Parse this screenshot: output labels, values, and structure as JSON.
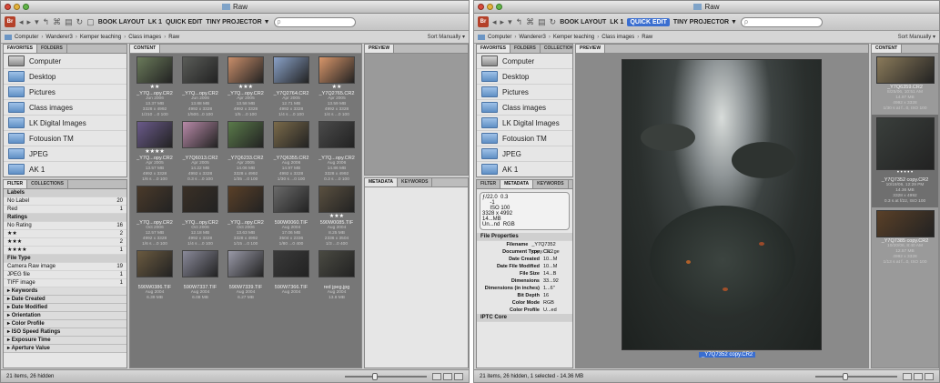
{
  "left_window": {
    "title": "Raw",
    "toolbar": {
      "workspaces": [
        "BOOK LAYOUT",
        "LK 1",
        "QUICK EDIT",
        "TINY PROJECTOR ▼"
      ],
      "search_placeholder": "ρ"
    },
    "path": [
      "Computer",
      "Wanderer3",
      "Kemper teaching",
      "Class images",
      "Raw"
    ],
    "sort_label": "Sort Manually ▾",
    "favorites_tabs": [
      "FAVORITES",
      "FOLDERS"
    ],
    "favorites": [
      "Computer",
      "Desktop",
      "Pictures",
      "Class images",
      "LK Digital Images",
      "Fotousion TM",
      "JPEG",
      "AK 1"
    ],
    "filter_tabs": [
      "FILTER",
      "COLLECTIONS"
    ],
    "filter": {
      "labels_header": "Labels",
      "labels": [
        {
          "name": "No Label",
          "count": "20"
        },
        {
          "name": "Red",
          "count": "1"
        }
      ],
      "ratings_header": "Ratings",
      "ratings": [
        {
          "name": "No Rating",
          "count": "16"
        },
        {
          "name": "★★",
          "count": "2"
        },
        {
          "name": "★★★",
          "count": "2"
        },
        {
          "name": "★★★★",
          "count": "1"
        }
      ],
      "filetype_header": "File Type",
      "filetypes": [
        {
          "name": "Camera Raw image",
          "count": "19"
        },
        {
          "name": "JPEG file",
          "count": "1"
        },
        {
          "name": "TIFF image",
          "count": "1"
        }
      ],
      "collapsed": [
        "Keywords",
        "Date Created",
        "Date Modified",
        "Orientation",
        "Color Profile",
        "ISO Speed Ratings",
        "Exposure Time",
        "Aperture Value"
      ]
    },
    "content_tab": "CONTENT",
    "preview_tab": "PREVIEW",
    "metadata_tabs": [
      "METADATA",
      "KEYWORDS"
    ],
    "thumbnails": [
      {
        "name": "_Y7Q...opy.CR2",
        "stars": "★★",
        "meta": [
          "Jun 2006",
          "13.37 MB",
          "3328 x 4992",
          "1/210 ...0 100"
        ],
        "color": "#6a7a5a"
      },
      {
        "name": "_Y7Q...opy.CR2",
        "stars": "",
        "meta": [
          "Jun 2006",
          "13.88 MB",
          "4992 x 3328",
          "1/500...0 100"
        ],
        "color": "#5a5c58"
      },
      {
        "name": "_Y7Q...opy.CR2",
        "stars": "★★★",
        "meta": [
          "Apr 2005",
          "13.58 MB",
          "4992 x 3328",
          "1/5 ...0 100"
        ],
        "color": "#c98e6a"
      },
      {
        "name": "_Y7Q2764.CR2",
        "stars": "",
        "meta": [
          "Apr 2005",
          "12.71 MB",
          "4992 x 3328",
          "1/4 s ...0 100"
        ],
        "color": "#8aa2c8"
      },
      {
        "name": "_Y7Q2765.CR2",
        "stars": "★★",
        "meta": [
          "Apr 2005",
          "13.59 MB",
          "4992 x 3328",
          "1/4 s ...0 100"
        ],
        "color": "#d8966a"
      },
      {
        "name": "_Y7Q...opy.CR2",
        "stars": "★★★★",
        "meta": [
          "Apr 2005",
          "13.57 MB",
          "4992 x 3328",
          "1/6 s ...0 100"
        ],
        "color": "#6a5a8a"
      },
      {
        "name": "_Y7Q6013.CR2",
        "stars": "",
        "meta": [
          "Apr 2005",
          "14.22 MB",
          "4992 x 3328",
          "0.3 s ...0 100"
        ],
        "color": "#b88aa8"
      },
      {
        "name": "_Y7Q6233.CR2",
        "stars": "",
        "meta": [
          "Apr 2005",
          "14.06 MB",
          "3328 x 4992",
          "1/35 ...0 100"
        ],
        "color": "#5a7a4a"
      },
      {
        "name": "_Y7Q6355.CR2",
        "stars": "",
        "meta": [
          "Aug 2006",
          "14.97 MB",
          "4992 x 3328",
          "1/30 s ...0 100"
        ],
        "color": "#7a6a4a"
      },
      {
        "name": "_Y7Q...opy.CR2",
        "stars": "",
        "meta": [
          "Aug 2006",
          "14.86 MB",
          "3328 x 4992",
          "0.3 s ...0 100"
        ],
        "color": "#4a4a4a"
      },
      {
        "name": "_Y7Q...opy.CR2",
        "stars": "",
        "meta": [
          "Oct 2006",
          "12.57 MB",
          "4992 x 3328",
          "1/6 s ...0 100"
        ],
        "color": "#4a3a2a"
      },
      {
        "name": "_Y7Q...opy.CR2",
        "stars": "",
        "meta": [
          "Oct 2006",
          "12.18 MB",
          "4992 x 3328",
          "1/4 s ...0 100"
        ],
        "color": "#3a3026"
      },
      {
        "name": "_Y7Q...opy.CR2",
        "stars": "",
        "meta": [
          "Oct 2006",
          "13.63 MB",
          "3328 x 4992",
          "1/15 ...0 100"
        ],
        "color": "#5a4028"
      },
      {
        "name": "590W0060.TIF",
        "stars": "",
        "meta": [
          "Aug 2004",
          "17.06 MB",
          "3504 x 2336",
          "1/80 ...0 400"
        ],
        "color": "#6a6a6a"
      },
      {
        "name": "590W0085.TIF",
        "stars": "★★★",
        "meta": [
          "Aug 2004",
          "8.25 MB",
          "2336 x 3504",
          "1/3 ...0 400"
        ],
        "color": "#5a5040"
      },
      {
        "name": "590W0386.TIF",
        "stars": "",
        "meta": [
          "Aug 2004",
          "6.39 MB",
          "",
          ""
        ],
        "color": "#6a5a40"
      },
      {
        "name": "590W7337.TIF",
        "stars": "",
        "meta": [
          "Aug 2004",
          "6.08 MB",
          "",
          ""
        ],
        "color": "#8a8a9a"
      },
      {
        "name": "590W7339.TIF",
        "stars": "",
        "meta": [
          "Aug 2004",
          "6.27 MB",
          "",
          ""
        ],
        "color": "#9a9aa8"
      },
      {
        "name": "590W7366.TIF",
        "stars": "",
        "meta": [
          "Aug 2004",
          "",
          "",
          ""
        ],
        "color": "#3a3a3a"
      },
      {
        "name": "red jpeg.jpg",
        "stars": "",
        "meta": [
          "Aug 2004",
          "13.8 MB",
          "",
          ""
        ],
        "color": "#4a4a42"
      }
    ],
    "status": "21 items, 26 hidden"
  },
  "right_window": {
    "title": "Raw",
    "toolbar": {
      "workspaces": [
        "BOOK LAYOUT",
        "LK 1",
        "QUICK EDIT",
        "TINY PROJECTOR ▼"
      ],
      "active": "QUICK EDIT",
      "search_placeholder": "ρ"
    },
    "path": [
      "Computer",
      "Wanderer3",
      "Kemper teaching",
      "Class images",
      "Raw"
    ],
    "sort_label": "Sort Manually ▾",
    "favorites_tabs": [
      "FAVORITES",
      "FOLDERS",
      "COLLECTIONS"
    ],
    "favorites": [
      "Computer",
      "Desktop",
      "Pictures",
      "Class images",
      "LK Digital Images",
      "Fotousion TM",
      "JPEG",
      "AK 1"
    ],
    "metadata_tabs": [
      "FILTER",
      "METADATA",
      "KEYWORDS"
    ],
    "exif": {
      "aperture": "ƒ/22.0",
      "shutter": "0.3",
      "ev": "-1",
      "iso": "ISO 100",
      "dims": "3328 x 4992",
      "size": "14...MB",
      "un": "Un...nd",
      "mode": "RGB"
    },
    "file_props_header": "File Properties",
    "file_props": [
      {
        "k": "Filename",
        "v": "_Y7Q7352 copy.CR2"
      },
      {
        "k": "Document Type",
        "v": "Ca...ge"
      },
      {
        "k": "Date Created",
        "v": "10...M"
      },
      {
        "k": "Date File Modified",
        "v": "10...M"
      },
      {
        "k": "File Size",
        "v": "14...B"
      },
      {
        "k": "Dimensions",
        "v": "33...92"
      },
      {
        "k": "Dimensions (in inches)",
        "v": "1...6\""
      },
      {
        "k": "Bit Depth",
        "v": "16"
      },
      {
        "k": "Color Mode",
        "v": "RGB"
      },
      {
        "k": "Color Profile",
        "v": "U...ed"
      }
    ],
    "iptc_header": "IPTC Core",
    "preview_tab": "PREVIEW",
    "content_tab": "CONTENT",
    "preview_caption": "_Y7Q7352 copy.CR2",
    "side_thumbs": [
      {
        "name": "_Y7Q6359.CR2",
        "meta": [
          "8/25/06, 10:51 AM",
          "14.97 MB",
          "4992 x 3328",
          "1/30 s at f...0, ISO 100"
        ]
      },
      {
        "name": "_Y7Q7352 copy.CR2",
        "meta": [
          "10/19/06, 12:29 PM",
          "14.36 MB",
          "3328 x 4992",
          "0.3 s at f/22, ISO 100"
        ],
        "stars": "• • • • •"
      },
      {
        "name": "_Y7Q7385 copy.CR2",
        "meta": [
          "10/20/06, 8:40 AM",
          "12.57 MB",
          "4992 x 3328",
          "1/13 s at f...0, ISO 100"
        ]
      }
    ],
    "status": "21 items, 26 hidden, 1 selected - 14.36 MB"
  }
}
